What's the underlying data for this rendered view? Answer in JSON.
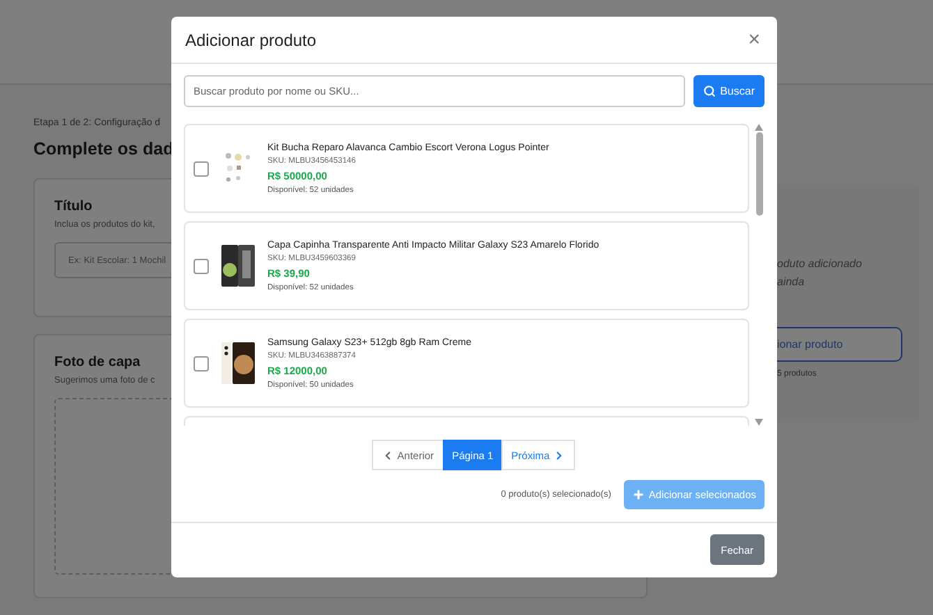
{
  "page": {
    "step": "Etapa 1 de 2: Configuração d",
    "heading": "Complete os dad",
    "title_card": {
      "title": "Título",
      "hint": "Inclua os produtos do kit,",
      "placeholder": "Ex: Kit Escolar: 1 Mochil"
    },
    "cover_card": {
      "title": "Foto de capa",
      "hint": "Sugerimos uma foto de c"
    },
    "side_card": {
      "empty_lines": [
        "oduto adicionado",
        "ainda"
      ],
      "button": "ionar produto",
      "note": "5 produtos"
    }
  },
  "modal": {
    "title": "Adicionar produto",
    "close": "×",
    "search": {
      "placeholder": "Buscar produto por nome ou SKU...",
      "button": "Buscar"
    },
    "products": [
      {
        "name": "Kit Bucha Reparo Alavanca Cambio Escort Verona Logus Pointer",
        "sku": "SKU: MLBU3456453146",
        "price": "R$ 50000,00",
        "stock": "Disponível: 52 unidades",
        "checked": false,
        "kind": "parts"
      },
      {
        "name": "Capa Capinha Transparente Anti Impacto Militar Galaxy S23 Amarelo Florido",
        "sku": "SKU: MLBU3459603369",
        "price": "R$ 39,90",
        "stock": "Disponível: 52 unidades",
        "checked": false,
        "kind": "case"
      },
      {
        "name": "Samsung Galaxy S23+ 512gb 8gb Ram Creme",
        "sku": "SKU: MLBU3463887374",
        "price": "R$ 12000,00",
        "stock": "Disponível: 50 unidades",
        "checked": false,
        "kind": "phone"
      }
    ],
    "pagination": [
      {
        "label": "Anterior",
        "kind": "prev",
        "selected": false
      },
      {
        "label": "Página 1",
        "kind": "page",
        "selected": true
      },
      {
        "label": "Próxima",
        "kind": "next",
        "selected": false
      }
    ],
    "selected_count": "0 produto(s) selecionado(s)",
    "add_button": "Adicionar selecionados",
    "close_button": "Fechar"
  }
}
